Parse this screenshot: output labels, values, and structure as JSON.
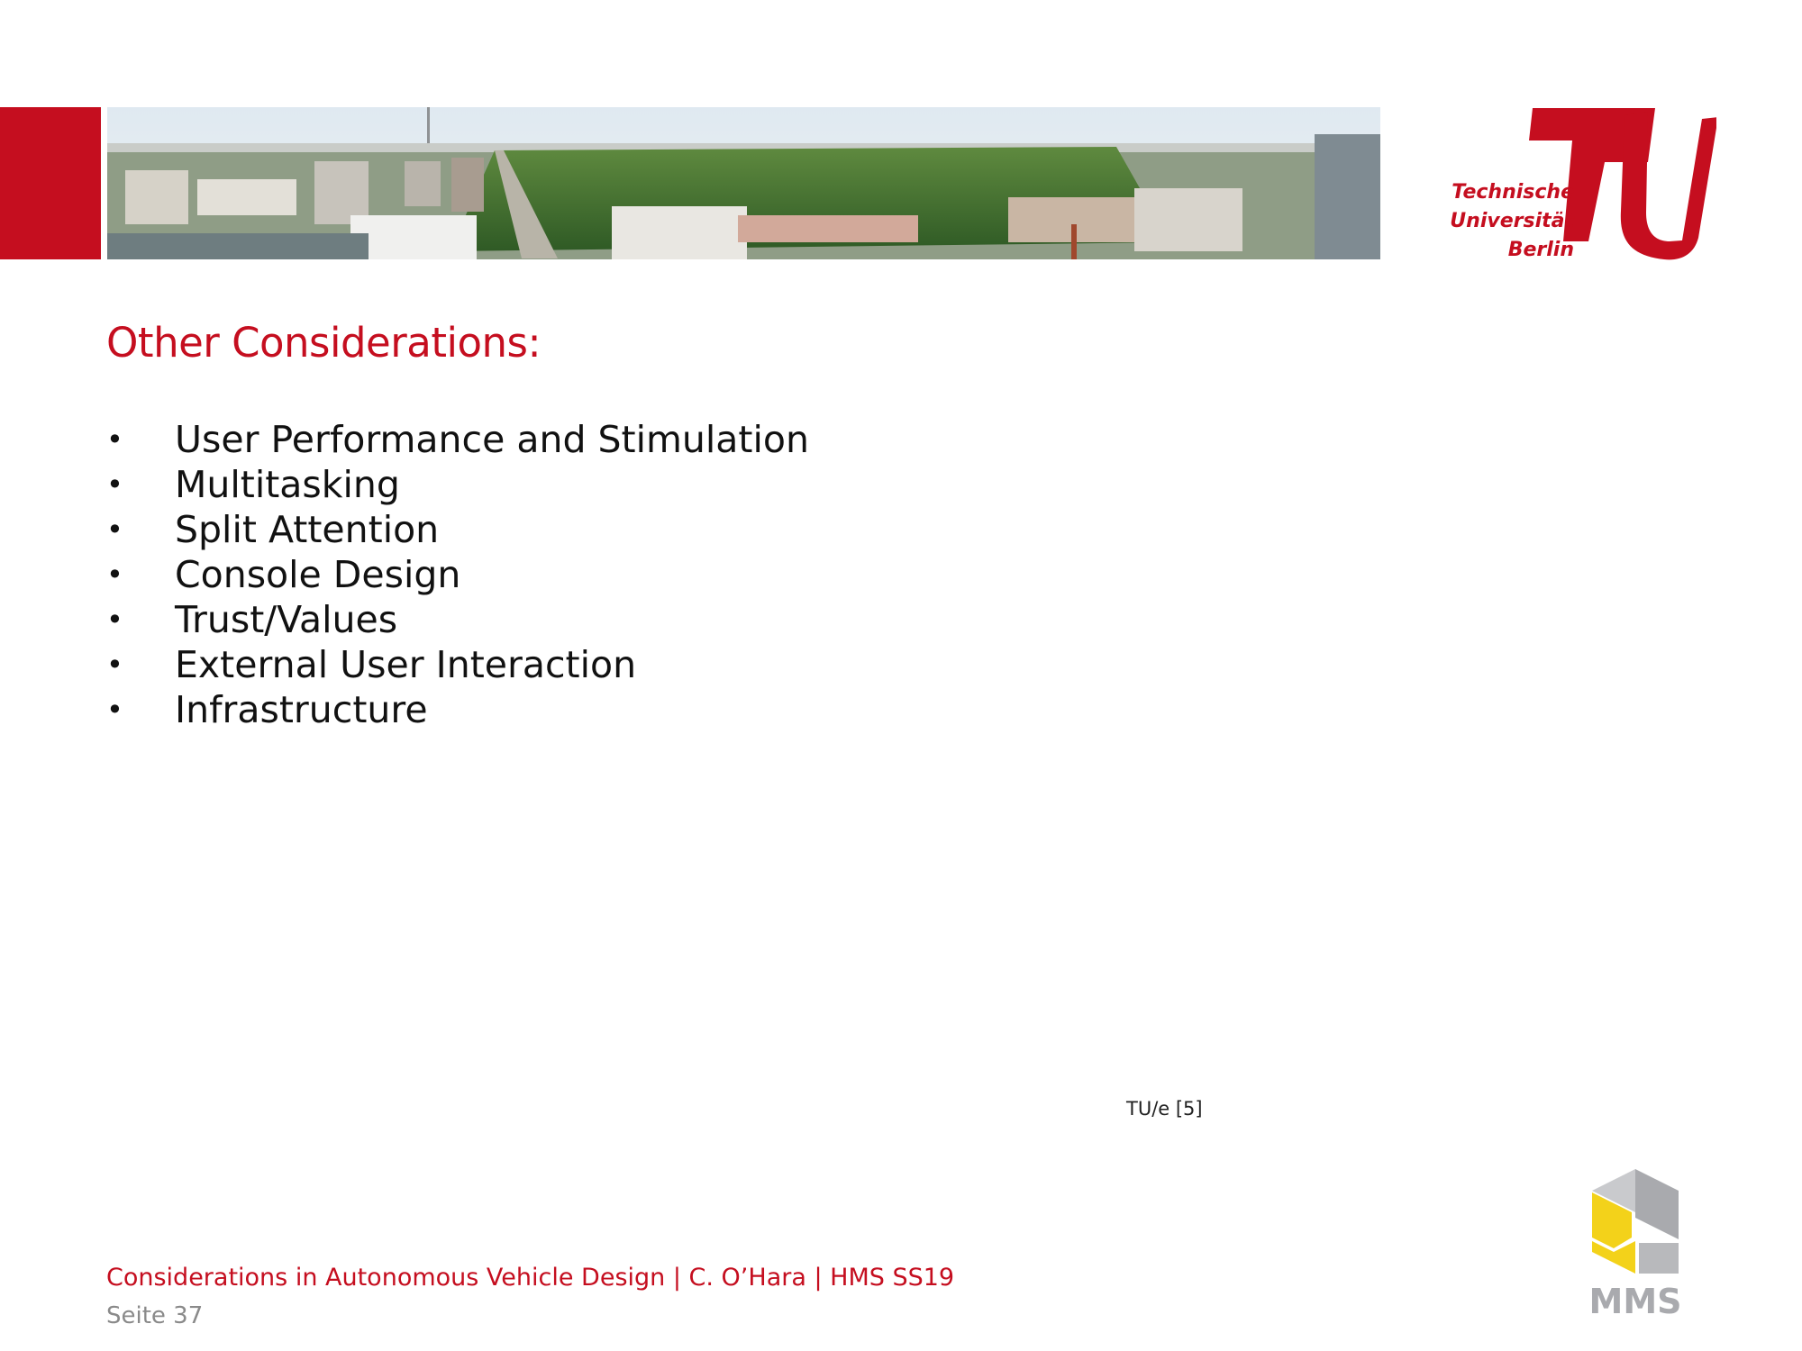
{
  "header": {
    "banner_alt": "Berlin skyline panorama",
    "logo": {
      "lines": [
        "Technische",
        "Universität",
        "Berlin"
      ],
      "tag": "berlin",
      "color": "#c50e1f"
    }
  },
  "slide": {
    "title": "Other Considerations:",
    "bullet_glyph": "•",
    "bullets": [
      "User Performance and Stimulation",
      "Multitasking",
      "Split Attention",
      "Console Design",
      "Trust/Values",
      "External User Interaction",
      "Infrastructure"
    ],
    "source_note": "TU/e [5]"
  },
  "footer": {
    "course_line": "Considerations in Autonomous Vehicle Design | C. O’Hara | HMS SS19",
    "page_label": "Seite 37",
    "mms_logo_text": "MMS"
  },
  "colors": {
    "accent": "#c50e1f",
    "text": "#111111",
    "muted": "#8a8a8a",
    "mms_yellow": "#f3d21a",
    "mms_gray": "#a9aaae"
  }
}
